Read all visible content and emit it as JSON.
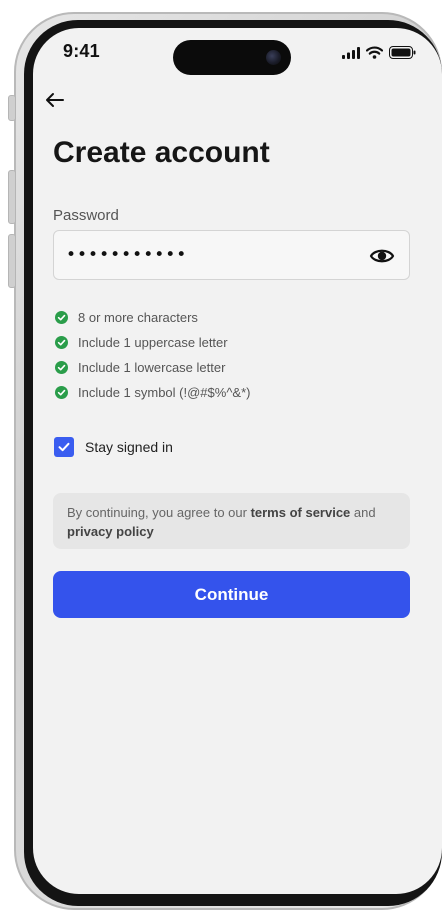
{
  "status_bar": {
    "time": "9:41"
  },
  "icons": {
    "back": "arrow-left-icon",
    "visibility": "eye-icon",
    "requirement": "check-circle-icon",
    "checkbox": "checkmark-icon",
    "signal": "signal-icon",
    "wifi": "wifi-icon",
    "battery": "battery-icon"
  },
  "page": {
    "title": "Create account"
  },
  "password": {
    "label": "Password",
    "value": "•••••••••••"
  },
  "requirements": [
    "8 or more characters",
    "Include 1 uppercase letter",
    "Include 1 lowercase letter",
    "Include 1 symbol (!@#$%^&*)"
  ],
  "stay_signed_in": {
    "label": "Stay signed in",
    "checked": true
  },
  "terms": {
    "prefix": "By continuing, you agree to our ",
    "terms_link": "terms of service",
    "middle": " and ",
    "privacy_link": "privacy policy"
  },
  "continue_button": {
    "label": "Continue"
  },
  "colors": {
    "accent": "#3453ec",
    "success": "#2a9d4a",
    "screen_bg": "#f2f2f2"
  }
}
